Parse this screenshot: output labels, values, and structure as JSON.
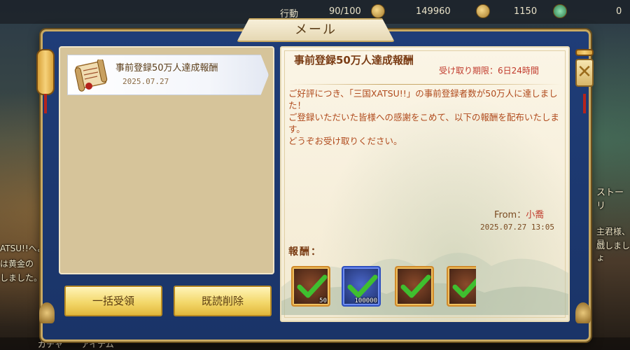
{
  "background": {
    "top_bar": {
      "stamina_label": "行動",
      "stamina_value": "90/100",
      "silver_value": "149960",
      "gold_value": "1150",
      "right_value": "0"
    },
    "left_texts": [
      "ATSU!!へよ",
      "は黄金の",
      "しました。"
    ],
    "right_texts": [
      "ストーリ",
      "主君様、早",
      "戯しましょ"
    ],
    "bottom_tabs": [
      "ガチャ",
      "アイテム"
    ]
  },
  "dialog": {
    "title": "メール"
  },
  "mail_list": [
    {
      "title": "事前登録50万人達成報酬",
      "date": "2025.07.27"
    }
  ],
  "buttons": {
    "receive_all": "一括受領",
    "delete_read": "既読削除"
  },
  "mail_detail": {
    "title": "事前登録50万人達成報酬",
    "deadline": "受け取り期限：6日24時間",
    "body": [
      "ご好評につき、「三国XATSU!!」の事前登録者数が50万人に達しました！",
      "ご登録いただいた皆様への感謝をこめて、以下の報酬を配布いたします。",
      "どうぞお受け取りください。"
    ],
    "from_label": "From：",
    "from_name": "小喬",
    "sent_date": "2025.07.27 13:05",
    "reward_label": "報酬：",
    "rewards": [
      {
        "icon": "chest-icon",
        "quantity": "50",
        "claimed": true
      },
      {
        "icon": "silver-coin-icon",
        "quantity": "100000",
        "claimed": true
      },
      {
        "icon": "chest-icon",
        "quantity": "",
        "claimed": true
      },
      {
        "icon": "chest-icon",
        "quantity": "",
        "claimed": true
      }
    ]
  },
  "colors": {
    "frame_blue": "#1f3d78",
    "gold_border": "#c9a961",
    "body_text": "#b04a1c",
    "deadline_red": "#c0392b",
    "check_green": "#3fbf2f"
  }
}
